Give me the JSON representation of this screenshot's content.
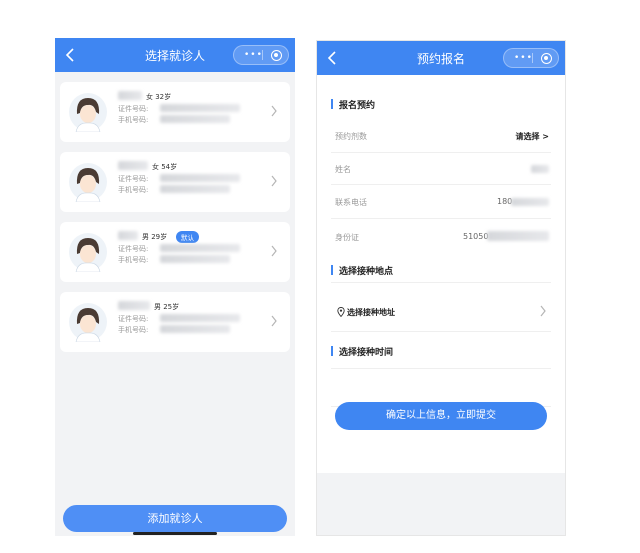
{
  "left_screen": {
    "title": "选择就诊人",
    "patients": [
      {
        "gender_age": "女 32岁",
        "id_label": "证件号码:",
        "phone_label": "手机号码:",
        "badge": ""
      },
      {
        "gender_age": "女 54岁",
        "id_label": "证件号码:",
        "phone_label": "手机号码:",
        "badge": ""
      },
      {
        "gender_age": "男 29岁",
        "id_label": "证件号码:",
        "phone_label": "手机号码:",
        "badge": "默认"
      },
      {
        "gender_age": "男 25岁",
        "id_label": "证件号码:",
        "phone_label": "手机号码:",
        "badge": ""
      }
    ],
    "add_button": "添加就诊人"
  },
  "right_screen": {
    "title": "预约报名",
    "section1_title": "报名预约",
    "rows": [
      {
        "label": "预约剂数",
        "value": "请选择 >"
      },
      {
        "label": "姓名",
        "value": ""
      },
      {
        "label": "联系电话",
        "value": "180"
      },
      {
        "label": "身份证",
        "value": "51050"
      }
    ],
    "section2_title": "选择接种地点",
    "location_label": "选择接种地址",
    "section3_title": "选择接种时间",
    "submit_button": "确定以上信息，立即提交"
  },
  "capsule": {
    "more_icon": "more-dots-icon",
    "close_icon": "target-icon"
  },
  "colors": {
    "primary": "#3f86f2",
    "background": "#f2f3f5"
  }
}
